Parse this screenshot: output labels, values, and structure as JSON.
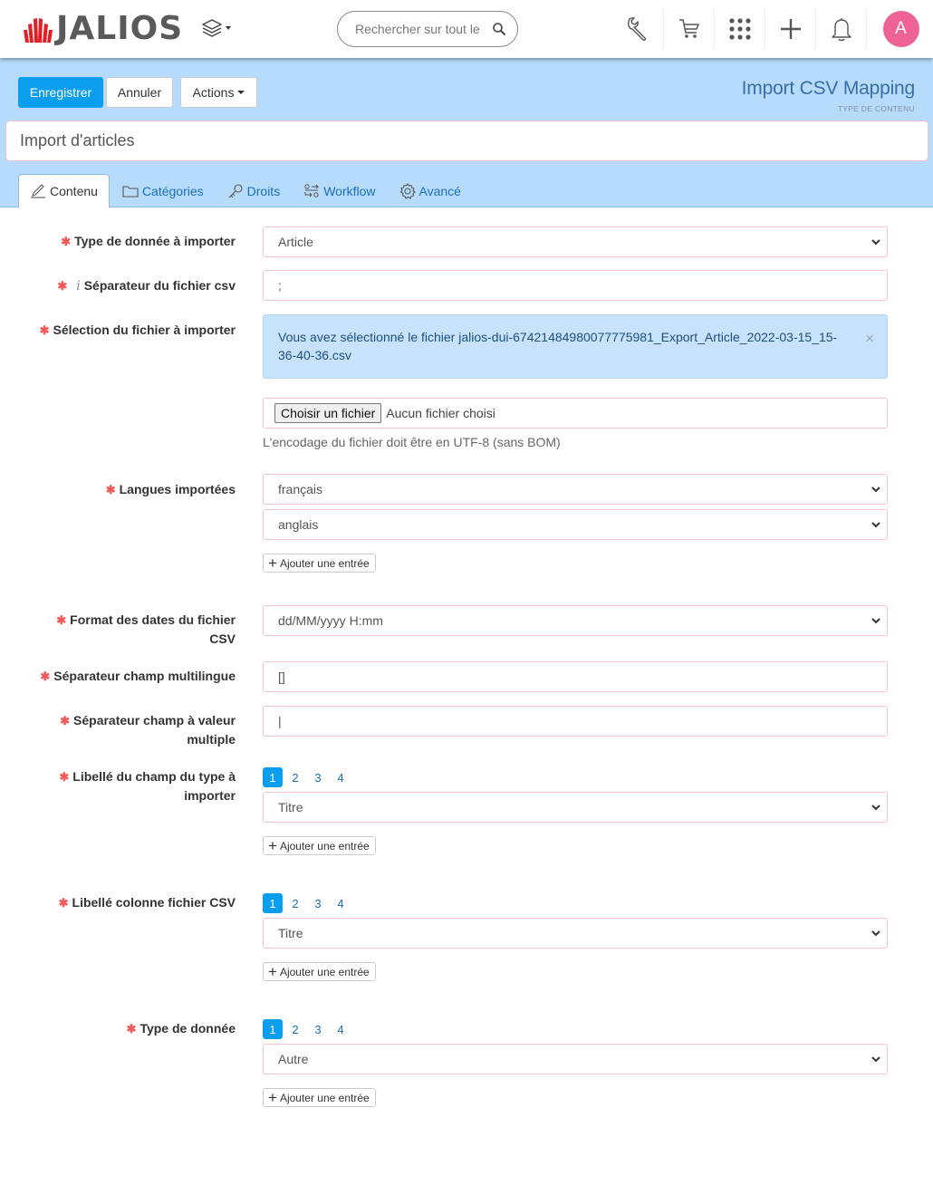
{
  "topbar": {
    "brand": "JALIOS",
    "search_placeholder": "Rechercher sur tout le",
    "avatar_initial": "A",
    "icons": [
      "wrench-icon",
      "cart-icon",
      "apps-grid-icon",
      "plus-icon",
      "bell-icon"
    ]
  },
  "toolbar": {
    "save_label": "Enregistrer",
    "cancel_label": "Annuler",
    "actions_label": "Actions"
  },
  "content_type": {
    "title": "Import CSV Mapping",
    "subtitle": "TYPE DE CONTENU"
  },
  "document": {
    "title_value": "Import d'articles"
  },
  "tabs": [
    {
      "label": "Contenu",
      "icon": "pencil-icon",
      "active": true
    },
    {
      "label": "Catégories",
      "icon": "folder-icon",
      "active": false
    },
    {
      "label": "Droits",
      "icon": "key-icon",
      "active": false
    },
    {
      "label": "Workflow",
      "icon": "workflow-icon",
      "active": false
    },
    {
      "label": "Avancé",
      "icon": "gear-icon",
      "active": false
    }
  ],
  "form": {
    "data_type": {
      "label": "Type de donnée à importer",
      "value": "Article"
    },
    "csv_separator": {
      "label": "Séparateur du fichier csv",
      "value": ";"
    },
    "file_selection": {
      "label": "Sélection du fichier à importer",
      "alert": "Vous avez sélectionné le fichier jalios-dui-67421484980077775981_Export_Article_2022-03-15_15-36-40-36.csv",
      "alert_close": "×",
      "choose_button": "Choisir un fichier",
      "no_file": "Aucun fichier choisi",
      "help": "L'encodage du fichier doit être en UTF-8 (sans BOM)"
    },
    "languages": {
      "label": "Langues importées",
      "values": [
        "français",
        "anglais"
      ],
      "add_label": "Ajouter une entrée"
    },
    "date_format": {
      "label": "Format des dates du fichier CSV",
      "value": "dd/MM/yyyy H:mm"
    },
    "multilang_separator": {
      "label": "Séparateur champ multilingue",
      "value": "[]"
    },
    "multivalue_separator": {
      "label": "Séparateur champ à valeur multiple",
      "value": "|"
    },
    "field_label": {
      "label": "Libellé du champ du type à importer",
      "pages": [
        "1",
        "2",
        "3",
        "4"
      ],
      "active_page": "1",
      "value": "Titre",
      "add_label": "Ajouter une entrée"
    },
    "csv_column_label": {
      "label": "Libellé colonne fichier CSV",
      "pages": [
        "1",
        "2",
        "3",
        "4"
      ],
      "active_page": "1",
      "value": "Titre",
      "add_label": "Ajouter une entrée"
    },
    "value_type": {
      "label": "Type de donnée",
      "pages": [
        "1",
        "2",
        "3",
        "4"
      ],
      "active_page": "1",
      "value": "Autre",
      "add_label": "Ajouter une entrée"
    }
  },
  "colors": {
    "primary": "#0b9eef",
    "header_band": "#b7dcfb",
    "required": "#f05a5a",
    "avatar": "#ef6295",
    "brand_red": "#e31e24"
  }
}
